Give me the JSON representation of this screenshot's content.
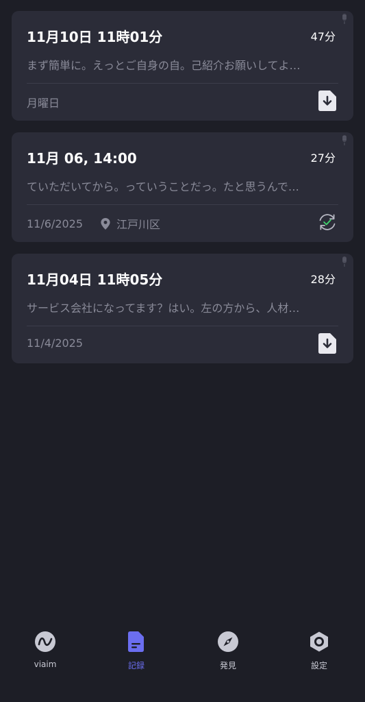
{
  "recordings": [
    {
      "title": "11月10日 11時01分",
      "duration": "47分",
      "preview": "まず簡単に。えっとご自身の自。己紹介お願いしてよ…",
      "date": "月曜日",
      "location": "",
      "action_icon": "download-doc-icon"
    },
    {
      "title": "11月 06, 14:00",
      "duration": "27分",
      "preview": "ていただいてから。っていうことだっ。たと思うんで…",
      "date": "11/6/2025",
      "location": "江戸川区",
      "action_icon": "sync-check-icon"
    },
    {
      "title": "11月04日 11時05分",
      "duration": "28分",
      "preview": "サービス会社になってます？はい。左の方から、人材…",
      "date": "11/4/2025",
      "location": "",
      "action_icon": "download-doc-icon"
    }
  ],
  "nav": {
    "items": [
      {
        "label": "viaim",
        "icon": "viaim-logo-icon",
        "active": false
      },
      {
        "label": "記録",
        "icon": "document-icon",
        "active": true
      },
      {
        "label": "発見",
        "icon": "compass-icon",
        "active": false
      },
      {
        "label": "設定",
        "icon": "settings-hexagon-icon",
        "active": false
      }
    ]
  },
  "colors": {
    "background": "#1d1e26",
    "card": "#2b2c38",
    "muted_text": "#8a8b99",
    "accent": "#6b6ef0",
    "sync_green": "#3fcf6b"
  }
}
